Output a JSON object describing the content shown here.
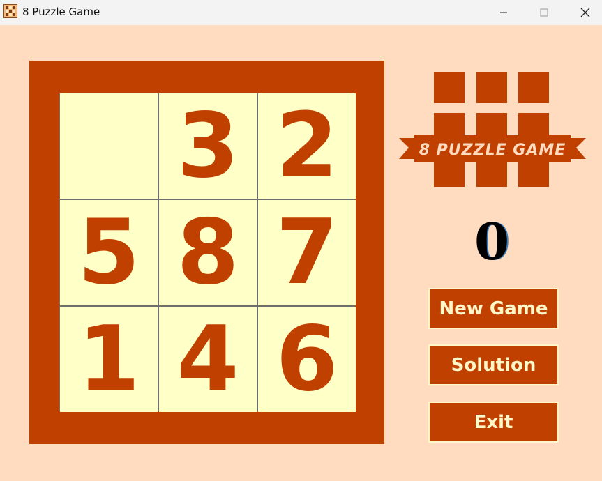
{
  "window": {
    "title": "8 Puzzle Game",
    "icon": "puzzle-grid-icon"
  },
  "window_controls": {
    "minimize_icon": "minimize-icon",
    "maximize_icon": "maximize-icon",
    "close_icon": "close-icon"
  },
  "board": {
    "tiles": [
      "",
      "3",
      "2",
      "5",
      "8",
      "7",
      "1",
      "4",
      "6"
    ]
  },
  "logo": {
    "text": "8 PUZZLE GAME"
  },
  "moves": {
    "count": "0"
  },
  "buttons": {
    "new_game": "New Game",
    "solution": "Solution",
    "exit": "Exit"
  },
  "colors": {
    "background": "#ffdcc0",
    "accent": "#c04000",
    "tile": "#ffffc8",
    "button_text": "#fff7c8"
  }
}
